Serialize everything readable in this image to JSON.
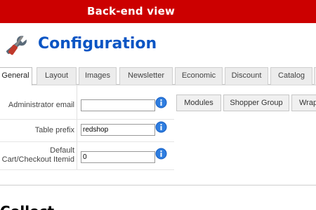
{
  "banner": {
    "text": "Back-end view",
    "color": "#cc0000"
  },
  "header": {
    "icon": "tools-icon",
    "title": "Configuration",
    "title_color": "#0b55c4"
  },
  "tabs": [
    {
      "label": "General",
      "active": true
    },
    {
      "label": "Layout"
    },
    {
      "label": "Images"
    },
    {
      "label": "Newsletter"
    },
    {
      "label": "Economic"
    },
    {
      "label": "Discount"
    },
    {
      "label": "Catalog"
    }
  ],
  "form": {
    "admin_email": {
      "label": "Administrator email",
      "value": ""
    },
    "table_prefix": {
      "label": "Table prefix",
      "value": "redshop"
    },
    "default_itemid": {
      "label_line1": "Default",
      "label_line2": "Cart/Checkout Itemid",
      "value": "0"
    },
    "info_icon": "info-icon"
  },
  "sub_buttons": [
    {
      "label": "Modules"
    },
    {
      "label": "Shopper Group"
    },
    {
      "label": "Wrap"
    }
  ],
  "next_section": {
    "heading": "Collect"
  }
}
